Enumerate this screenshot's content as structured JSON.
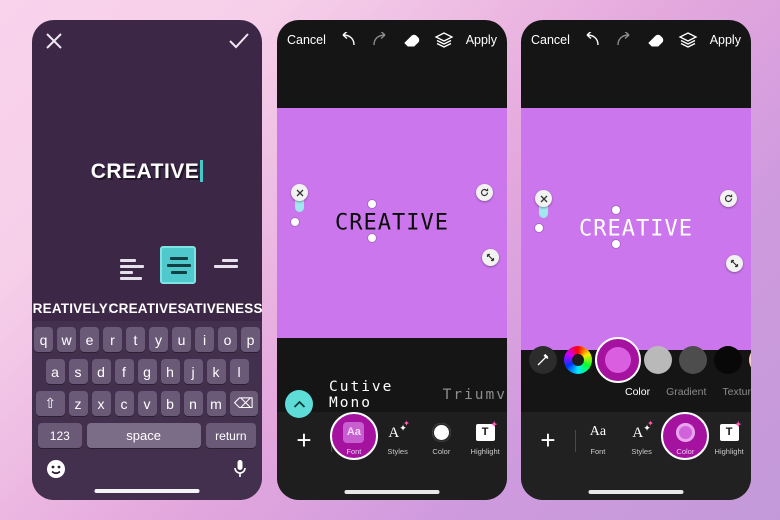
{
  "theme": {
    "bg_gradient_from": "#f9d2ec",
    "bg_gradient_to": "#c39ad9",
    "phone1_bg": "#3c2747",
    "canvas_purple": "#cb76ec",
    "dock_black": "#1e1e1e",
    "accent_magenta": "#a5129f",
    "accent_teal": "#4fc9cb"
  },
  "phone1": {
    "name": "text-editor-keyboard-screen",
    "close_icon": "close-icon",
    "confirm_icon": "check-icon",
    "text_value": "CREATIVE",
    "align_options": [
      "align-left",
      "align-center",
      "align-right"
    ],
    "align_selected": "align-center",
    "color_swatch": "#a5129f",
    "suggestions": [
      "REATIVELY",
      "CREATIVES",
      "ATIVENESS"
    ],
    "keyboard": {
      "row1": [
        "q",
        "w",
        "e",
        "r",
        "t",
        "y",
        "u",
        "i",
        "o",
        "p"
      ],
      "row2": [
        "a",
        "s",
        "d",
        "f",
        "g",
        "h",
        "j",
        "k",
        "l"
      ],
      "row3": [
        "z",
        "x",
        "c",
        "v",
        "b",
        "n",
        "m"
      ],
      "shift_label": "⇧",
      "backspace_label": "⌫",
      "numbers_label": "123",
      "space_label": "space",
      "return_label": "return",
      "emoji_icon": "emoji-icon",
      "mic_icon": "microphone-icon"
    }
  },
  "phone2": {
    "name": "font-picker-screen",
    "toolbar": {
      "cancel_label": "Cancel",
      "undo_icon": "undo-icon",
      "redo_icon": "redo-icon",
      "eraser_icon": "eraser-icon",
      "layers_icon": "layers-icon",
      "apply_label": "Apply"
    },
    "canvas_text": "CREATIVE",
    "canvas_text_color": "#0b0b0b",
    "selection_handles": [
      "delete-handle",
      "rotate-handle",
      "resize-handle"
    ],
    "collapse_icon": "chevron-up-icon",
    "fonts": [
      {
        "label": "Cutive Mono",
        "active": true
      },
      {
        "label": "Triumv",
        "active": false
      }
    ],
    "dock": {
      "add_label": "+",
      "items": [
        {
          "label": "Font",
          "icon": "font-aa-icon",
          "selected": true
        },
        {
          "label": "Styles",
          "icon": "styles-sparkle-icon",
          "selected": false
        },
        {
          "label": "Color",
          "icon": "color-circle-icon",
          "selected": false
        },
        {
          "label": "Highlight",
          "icon": "highlight-t-icon",
          "selected": false
        }
      ]
    }
  },
  "phone3": {
    "name": "color-picker-screen",
    "toolbar": {
      "cancel_label": "Cancel",
      "undo_icon": "undo-icon",
      "redo_icon": "redo-icon",
      "eraser_icon": "eraser-icon",
      "layers_icon": "layers-icon",
      "apply_label": "Apply"
    },
    "canvas_text": "CREATIVE",
    "canvas_text_color": "#ffffff",
    "selection_handles": [
      "delete-handle",
      "rotate-handle",
      "resize-handle"
    ],
    "swatches": [
      {
        "name": "eyedropper",
        "color": "#2c2c2c"
      },
      {
        "name": "color-wheel",
        "color": "rainbow"
      },
      {
        "name": "selected-magenta",
        "color": "#a5129f",
        "selected": true
      },
      {
        "name": "light-gray",
        "color": "#b9b9b9"
      },
      {
        "name": "dark-gray",
        "color": "#4d4d4d"
      },
      {
        "name": "black",
        "color": "#080808"
      },
      {
        "name": "pink",
        "color": "#f9c9cd"
      },
      {
        "name": "peach",
        "color": "#f6d7cb"
      }
    ],
    "tabs": [
      {
        "label": "Color",
        "active": true
      },
      {
        "label": "Gradient",
        "active": false
      },
      {
        "label": "Texture",
        "active": false
      }
    ],
    "dock": {
      "add_label": "+",
      "items": [
        {
          "label": "Font",
          "icon": "font-aa-icon",
          "selected": false
        },
        {
          "label": "Styles",
          "icon": "styles-sparkle-icon",
          "selected": false
        },
        {
          "label": "Color",
          "icon": "color-circle-icon",
          "selected": true
        },
        {
          "label": "Highlight",
          "icon": "highlight-t-icon",
          "selected": false
        }
      ]
    }
  }
}
